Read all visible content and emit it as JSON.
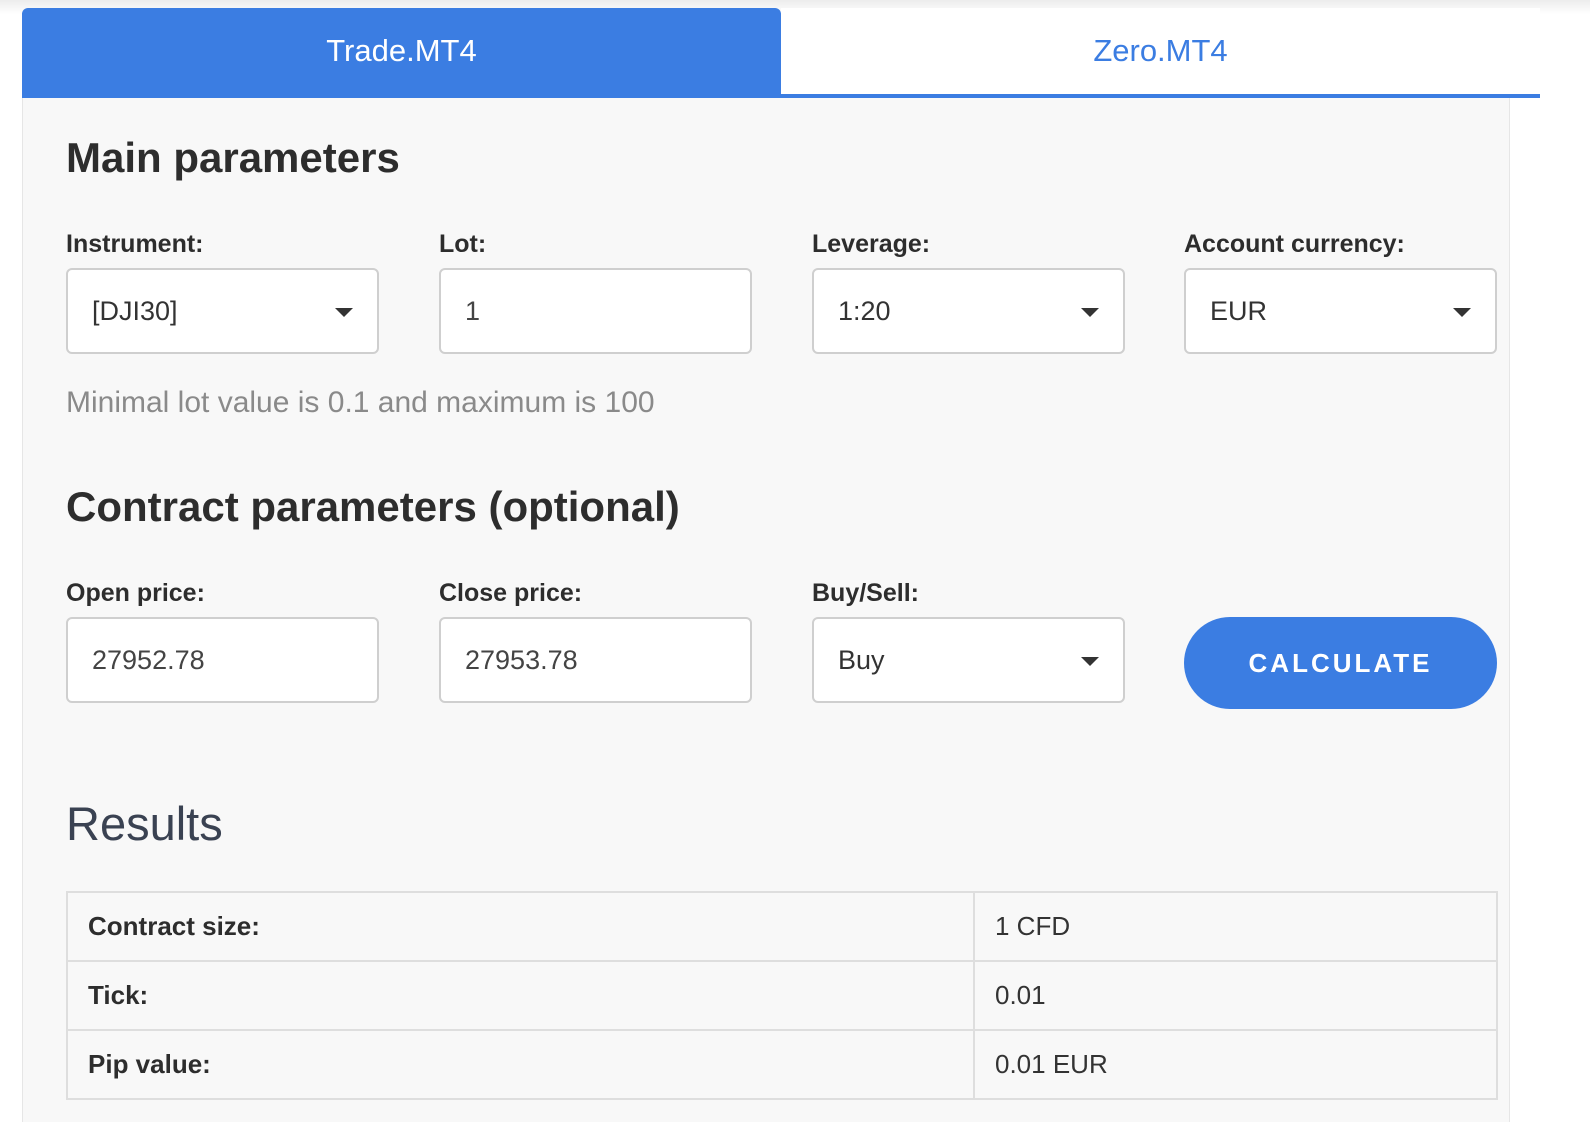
{
  "tabs": [
    {
      "label": "Trade.MT4",
      "active": true
    },
    {
      "label": "Zero.MT4",
      "active": false
    }
  ],
  "main_parameters": {
    "title": "Main parameters",
    "instrument": {
      "label": "Instrument:",
      "value": "[DJI30]"
    },
    "lot": {
      "label": "Lot:",
      "value": "1"
    },
    "leverage": {
      "label": "Leverage:",
      "value": "1:20"
    },
    "account_currency": {
      "label": "Account currency:",
      "value": "EUR"
    },
    "hint": "Minimal lot value is 0.1 and maximum is 100"
  },
  "contract_parameters": {
    "title": "Contract parameters (optional)",
    "open_price": {
      "label": "Open price:",
      "value": "27952.78"
    },
    "close_price": {
      "label": "Close price:",
      "value": "27953.78"
    },
    "buy_sell": {
      "label": "Buy/Sell:",
      "value": "Buy"
    },
    "calculate_label": "CALCULATE"
  },
  "results": {
    "title": "Results",
    "rows": [
      {
        "label": "Contract size:",
        "value": "1 CFD"
      },
      {
        "label": "Tick:",
        "value": "0.01"
      },
      {
        "label": "Pip value:",
        "value": "0.01 EUR"
      }
    ]
  },
  "colors": {
    "accent": "#3b7de2",
    "panel_bg": "#f8f8f8",
    "hint_text": "#8a8a8a"
  }
}
